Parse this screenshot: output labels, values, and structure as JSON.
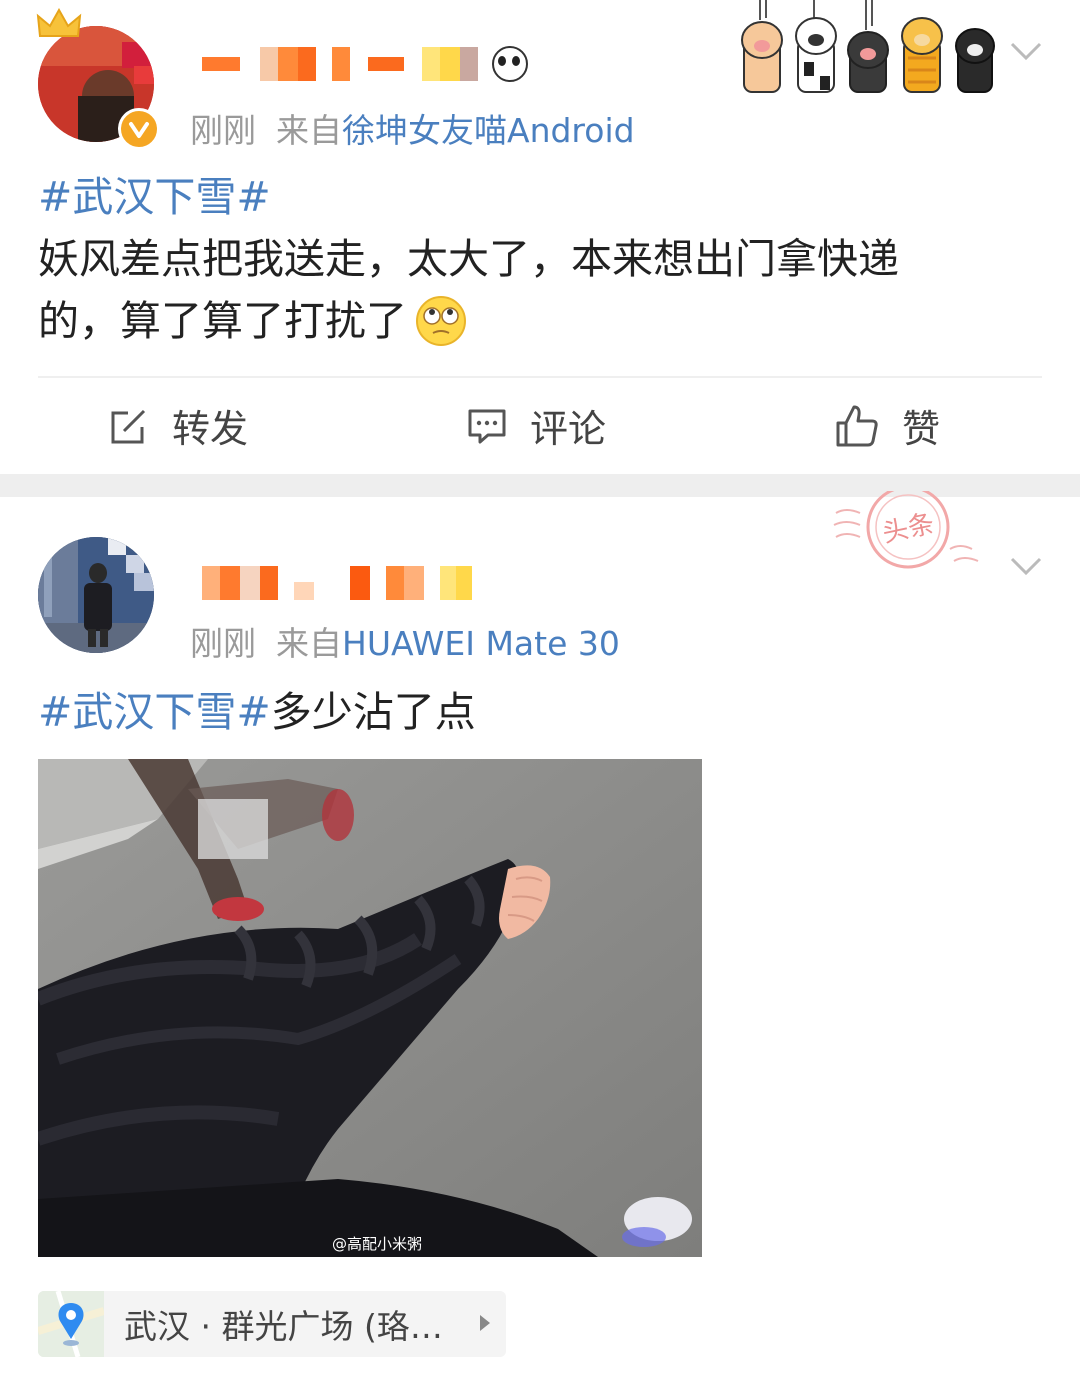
{
  "posts": [
    {
      "time": "刚刚",
      "from_label": "来自",
      "source": "徐坤女友喵Android",
      "topic": "#武汉下雪#",
      "text_line1": "妖风差点把我送走，太大了，本来想出门拿快递",
      "text_line2": "的，算了算了打扰了",
      "actions": {
        "repost_label": "转发",
        "comment_label": "评论",
        "like_label": "赞"
      }
    },
    {
      "time": "刚刚",
      "from_label": "来自",
      "source": "HUAWEI Mate 30",
      "topic": "#武汉下雪#",
      "text": "多少沾了点",
      "photo_watermark": "@高配小米粥",
      "location": "武汉 · 群光广场 (珞…",
      "stamp_text": "头条"
    }
  ],
  "colors": {
    "link_blue": "#4a7fbf",
    "meta_gray": "#9a9a9a",
    "divider": "#eeeeee",
    "verified_badge": "#f5a623"
  },
  "icons": {
    "verified": "verified-v-icon",
    "chevron": "chevron-down-icon",
    "repost": "edit-share-icon",
    "comment": "comment-bubble-icon",
    "like": "thumbs-up-icon",
    "location": "map-pin-icon",
    "paws": "cat-paw-stickers"
  }
}
